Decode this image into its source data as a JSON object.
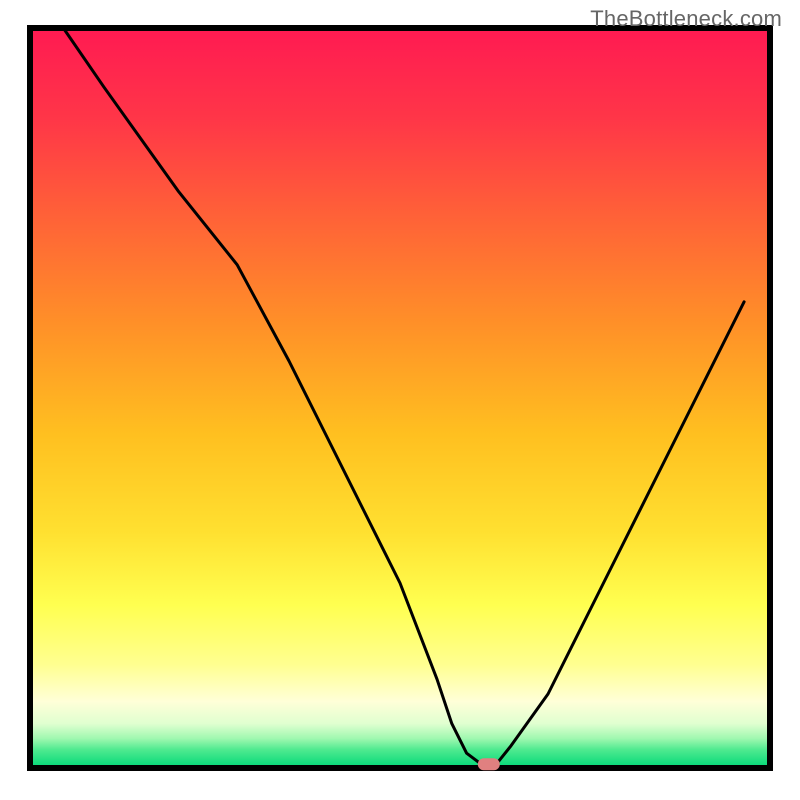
{
  "watermark": "TheBottleneck.com",
  "chart_data": {
    "type": "line",
    "title": "",
    "xlabel": "",
    "ylabel": "",
    "xlim": [
      0,
      100
    ],
    "ylim": [
      0,
      100
    ],
    "x": [
      4.5,
      10,
      20,
      28,
      35,
      40,
      45,
      50,
      55,
      57,
      59,
      61,
      63,
      65,
      70,
      75,
      80,
      85,
      90,
      95,
      96.5
    ],
    "y": [
      100,
      92,
      78,
      68,
      55,
      45,
      35,
      25,
      12,
      6,
      2,
      0.5,
      0.5,
      3,
      10,
      20,
      30,
      40,
      50,
      60,
      63
    ],
    "marker": {
      "x": 62,
      "y": 0.5,
      "color": "#e08080"
    },
    "colors": {
      "gradient_top": "#ff1744",
      "gradient_mid1": "#ff6030",
      "gradient_mid2": "#ffa020",
      "gradient_mid3": "#ffd030",
      "gradient_lower": "#ffff60",
      "gradient_pale": "#ffffd0",
      "gradient_green": "#00e676",
      "line": "#000000",
      "frame": "#000000"
    }
  }
}
